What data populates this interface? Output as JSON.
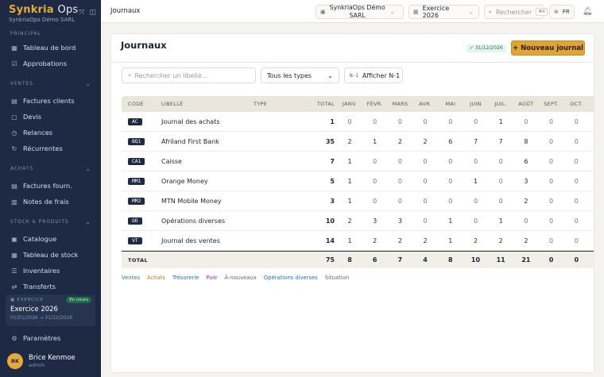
{
  "app": {
    "brand_main": "Synkria",
    "brand_suffix": "Ops",
    "org_name": "SynkriaOps Démo SARL"
  },
  "sidebar": {
    "sections": [
      {
        "title": "Principal",
        "items": [
          "Tableau de bord",
          "Approbations"
        ]
      },
      {
        "title": "Ventes",
        "items": [
          "Factures clients",
          "Devis",
          "Relances",
          "Récurrentes"
        ]
      },
      {
        "title": "Achats",
        "items": [
          "Factures fourn.",
          "Notes de frais"
        ]
      },
      {
        "title": "Stock & produits",
        "items": [
          "Catalogue",
          "Tableau de stock",
          "Inventaires",
          "Transferts"
        ]
      }
    ],
    "exercise_card": {
      "label": "EXERCICE",
      "badge": "En cours",
      "name": "Exercice 2026",
      "dates": "01/01/2026 → 31/12/2026"
    },
    "settings_label": "Paramètres",
    "user": {
      "initials": "BK",
      "name": "Brice Kenmoe",
      "role": "admin"
    }
  },
  "topbar": {
    "breadcrumb": "Journaux",
    "org_selector": "SynkriaOps Démo SARL",
    "year_selector": "Exercice 2026",
    "search_placeholder": "Rechercher",
    "search_shortcut": "⌘K",
    "language": "FR"
  },
  "page": {
    "title": "Journaux",
    "period_badge": "31/12/2026",
    "new_button": "Nouveau journal",
    "search_placeholder": "Rechercher un libellé...",
    "type_filter": "Tous les types",
    "toggle_kbd": "N-1",
    "toggle_label": "Afficher N-1"
  },
  "table": {
    "headers": {
      "code": "CODE",
      "label": "LIBELLÉ",
      "type": "TYPE",
      "total": "TOTAL",
      "months": [
        "JANV.",
        "FÉVR.",
        "MARS",
        "AVR.",
        "MAI",
        "JUIN",
        "JUIL.",
        "AOÛT",
        "SEPT.",
        "OCT."
      ]
    },
    "rows": [
      {
        "code": "AC",
        "label": "Journal des achats",
        "type": "",
        "total": "1",
        "months": [
          "0",
          "0",
          "0",
          "0",
          "0",
          "0",
          "1",
          "0",
          "0",
          "0"
        ]
      },
      {
        "code": "BQ1",
        "label": "Afriland First Bank",
        "type": "",
        "total": "35",
        "months": [
          "2",
          "1",
          "2",
          "2",
          "6",
          "7",
          "7",
          "8",
          "0",
          "0"
        ]
      },
      {
        "code": "CA1",
        "label": "Caisse",
        "type": "",
        "total": "7",
        "months": [
          "1",
          "0",
          "0",
          "0",
          "0",
          "0",
          "0",
          "6",
          "0",
          "0"
        ]
      },
      {
        "code": "MM1",
        "label": "Orange Money",
        "type": "",
        "total": "5",
        "months": [
          "1",
          "0",
          "0",
          "0",
          "0",
          "1",
          "0",
          "3",
          "0",
          "0"
        ]
      },
      {
        "code": "MM2",
        "label": "MTN Mobile Money",
        "type": "",
        "total": "3",
        "months": [
          "1",
          "0",
          "0",
          "0",
          "0",
          "0",
          "0",
          "2",
          "0",
          "0"
        ]
      },
      {
        "code": "OD",
        "label": "Opérations diverses",
        "type": "",
        "total": "10",
        "months": [
          "2",
          "3",
          "3",
          "0",
          "1",
          "0",
          "1",
          "0",
          "0",
          "0"
        ]
      },
      {
        "code": "VT",
        "label": "Journal des ventes",
        "type": "",
        "total": "14",
        "months": [
          "1",
          "2",
          "2",
          "2",
          "1",
          "2",
          "2",
          "2",
          "0",
          "0"
        ]
      }
    ],
    "footer": {
      "label": "TOTAL",
      "total": "75",
      "months": [
        "8",
        "6",
        "7",
        "4",
        "8",
        "10",
        "11",
        "21",
        "0",
        "0"
      ]
    }
  },
  "legend": [
    {
      "label": "Ventes",
      "color": "#2f8a4e"
    },
    {
      "label": "Achats",
      "color": "#b7791f"
    },
    {
      "label": "Trésorerie",
      "color": "#2b6cb0"
    },
    {
      "label": "Paie",
      "color": "#8a3fb8"
    },
    {
      "label": "À-nouveaux",
      "color": "#666666"
    },
    {
      "label": "Opérations diverses",
      "color": "#2b6cb0"
    },
    {
      "label": "Situation",
      "color": "#666666"
    }
  ]
}
